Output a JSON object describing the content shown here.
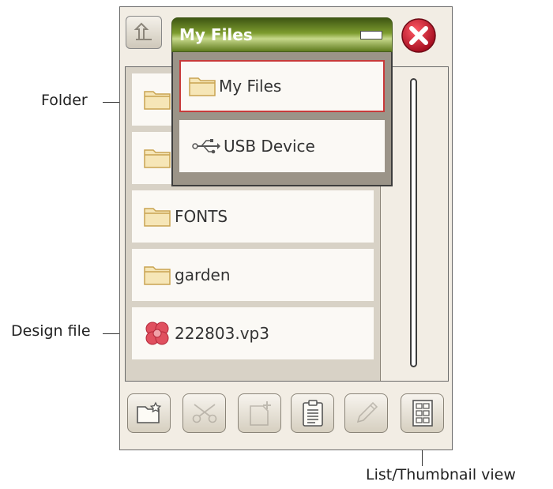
{
  "callouts": {
    "folder": "Folder",
    "design_file": "Design file",
    "view_toggle": "List/Thumbnail view"
  },
  "dropdown": {
    "title": "My Files",
    "items": [
      {
        "label": "My Files",
        "icon": "folder-icon",
        "selected": true
      },
      {
        "label": "USB Device",
        "icon": "usb-icon",
        "selected": false
      }
    ]
  },
  "files": [
    {
      "label": "",
      "icon": "folder-icon"
    },
    {
      "label": "",
      "icon": "folder-icon"
    },
    {
      "label": "FONTS",
      "icon": "folder-icon"
    },
    {
      "label": "garden",
      "icon": "folder-icon"
    },
    {
      "label": "222803.vp3",
      "icon": "design-file-icon"
    }
  ],
  "toolbar": [
    {
      "name": "new-folder-button",
      "icon": "new-folder-icon",
      "enabled": true
    },
    {
      "name": "cut-button",
      "icon": "scissors-icon",
      "enabled": false
    },
    {
      "name": "copy-button",
      "icon": "copy-icon",
      "enabled": false
    },
    {
      "name": "paste-button",
      "icon": "clipboard-icon",
      "enabled": true
    },
    {
      "name": "rename-button",
      "icon": "pencil-icon",
      "enabled": false
    },
    {
      "name": "list-thumbnail-button",
      "icon": "grid-view-icon",
      "enabled": true
    }
  ],
  "colors": {
    "header_green": "#6b8a22",
    "selection_red": "#c83a3a",
    "close_red": "#c0182a",
    "folder": "#e3c47e",
    "panel_bg": "#f2ede4"
  }
}
